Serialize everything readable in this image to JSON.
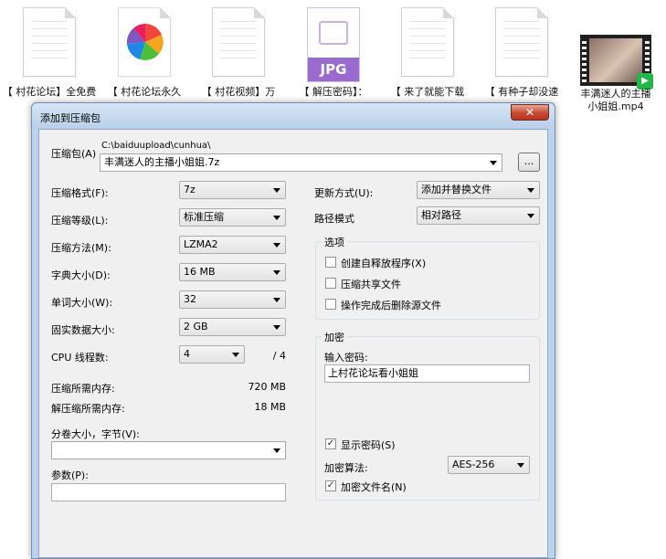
{
  "desktop": {
    "files": [
      {
        "type": "doc",
        "caption": "【 村花论坛】全免费"
      },
      {
        "type": "app",
        "caption": "【 村花论坛永久"
      },
      {
        "type": "doc",
        "caption": "【 村花视频】万"
      },
      {
        "type": "jpg",
        "caption": "【 解压密码】：",
        "badge": "JPG"
      },
      {
        "type": "doc",
        "caption": "【 来了就能下载"
      },
      {
        "type": "doc",
        "caption": "【 有种子却没速"
      },
      {
        "type": "video",
        "caption_line1": "丰满迷人的主播",
        "caption_line2": "小姐姐.mp4"
      }
    ]
  },
  "dialog": {
    "title": "添加到压缩包",
    "close_label": "✕",
    "archive": {
      "label": "压缩包(A)",
      "path": "C:\\baiduupload\\cunhua\\",
      "value": "丰满迷人的主播小姐姐.7z",
      "browse_label": "..."
    },
    "left": [
      {
        "label": "压缩格式(F):",
        "value": "7z"
      },
      {
        "label": "压缩等级(L):",
        "value": "标准压缩"
      },
      {
        "label": "压缩方法(M):",
        "value": "LZMA2"
      },
      {
        "label": "字典大小(D):",
        "value": "16 MB"
      },
      {
        "label": "单词大小(W):",
        "value": "32"
      },
      {
        "label": "固实数据大小:",
        "value": "2 GB"
      }
    ],
    "cpu": {
      "label": "CPU 线程数:",
      "value": "4",
      "max": "/ 4"
    },
    "memory": {
      "compress_label": "压缩所需内存:",
      "compress_value": "720 MB",
      "decompress_label": "解压缩所需内存:",
      "decompress_value": "18 MB"
    },
    "volume": {
      "label": "分卷大小，字节(V):",
      "value": ""
    },
    "params": {
      "label": "参数(P):",
      "value": ""
    },
    "update": {
      "label": "更新方式(U):",
      "value": "添加并替换文件"
    },
    "path_mode": {
      "label": "路径模式",
      "value": "相对路径"
    },
    "options": {
      "title": "选项",
      "items": [
        {
          "label": "创建自释放程序(X)",
          "checked": false
        },
        {
          "label": "压缩共享文件",
          "checked": false
        },
        {
          "label": "操作完成后删除源文件",
          "checked": false
        }
      ]
    },
    "encryption": {
      "title": "加密",
      "password_label": "输入密码:",
      "password_value": "上村花论坛看小姐姐",
      "show_password": {
        "label": "显示密码(S)",
        "checked": true
      },
      "method_label": "加密算法:",
      "method_value": "AES-256",
      "encrypt_names": {
        "label": "加密文件名(N)",
        "checked": true
      },
      "check_glyph": "✓"
    }
  }
}
